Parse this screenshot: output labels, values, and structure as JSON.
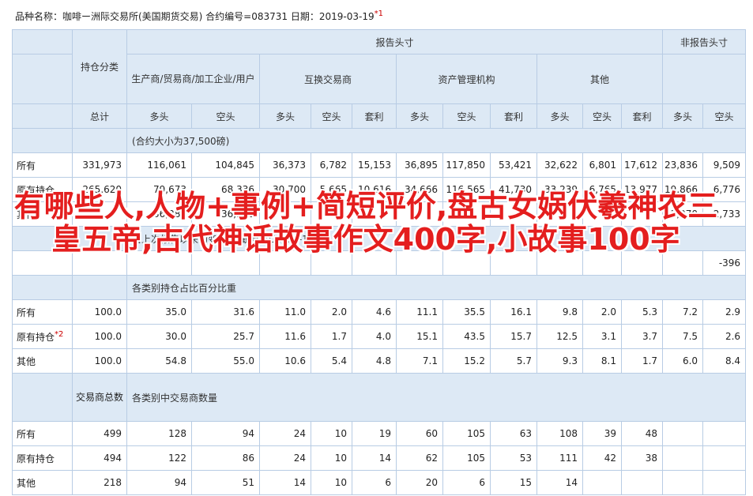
{
  "header_line": {
    "text": "品种名称：咖啡ー洲际交易所(美国期货交易) 合约编号=083731 日期：2019-03-19",
    "note": "*1"
  },
  "table": {
    "row1": {
      "holding_category": "持仓分类",
      "report_header": "报告头寸",
      "nonreport_header": "非报告头寸"
    },
    "row2": {
      "producer": "生产商/贸易商/加工企业/用户",
      "swap": "互换交易商",
      "asset_mgr": "资产管理机构",
      "other": "其他"
    },
    "row3": {
      "total": "总计",
      "cols": [
        "多头",
        "空头",
        "多头",
        "空头",
        "套利",
        "多头",
        "空头",
        "套利",
        "多头",
        "空头",
        "套利",
        "多头",
        "空头"
      ]
    },
    "contract_size": "(合约大小为37,500磅)",
    "block1": [
      {
        "label": "所有",
        "values": [
          "331,973",
          "116,061",
          "104,845",
          "36,373",
          "6,782",
          "15,153",
          "36,895",
          "117,850",
          "53,421",
          "32,622",
          "6,801",
          "17,612",
          "23,836",
          "9,509"
        ]
      },
      {
        "label": "原有持仓",
        "values": [
          "265,620",
          "79,673",
          "68,336",
          "30,700",
          "5,665",
          "10,616",
          "34,666",
          "116,565",
          "41,730",
          "33,239",
          "6,765",
          "13,977",
          "19,866",
          "6,776"
        ]
      },
      {
        "label": "其他",
        "values": [
          "",
          "36,388",
          "36,510",
          "",
          "",
          "",
          "",
          "",
          "",
          "",
          "",
          "",
          "3,970",
          "2,733"
        ]
      }
    ],
    "change_header": "自上次报告以来的变化量(截至2019-03-12)",
    "change_row": {
      "values": [
        "",
        "",
        "",
        "",
        "",
        "",
        "",
        "",
        "",
        "",
        "",
        "",
        "",
        "-396"
      ]
    },
    "pct_header": "各类别持仓占比百分比重",
    "block2": [
      {
        "label": "所有",
        "values": [
          "100.0",
          "35.0",
          "31.6",
          "11.0",
          "2.0",
          "4.6",
          "11.1",
          "35.5",
          "16.1",
          "9.8",
          "2.0",
          "5.3",
          "7.2",
          "2.9"
        ]
      },
      {
        "label": "原有持仓",
        "note": "*2",
        "values": [
          "100.0",
          "30.0",
          "25.7",
          "11.6",
          "1.7",
          "4.0",
          "15.1",
          "43.5",
          "15.7",
          "12.5",
          "3.1",
          "3.7",
          "7.5",
          "2.6"
        ]
      },
      {
        "label": "其他",
        "values": [
          "100.0",
          "54.8",
          "55.0",
          "10.6",
          "5.4",
          "4.8",
          "7.1",
          "15.2",
          "5.7",
          "9.3",
          "8.1",
          "1.7",
          "6.0",
          "8.4"
        ]
      }
    ],
    "trader_count": "交易商总数",
    "trader_header": "各类别中交易商数量",
    "block3": [
      {
        "label": "所有",
        "values": [
          "499",
          "128",
          "94",
          "24",
          "10",
          "19",
          "60",
          "105",
          "63",
          "108",
          "39",
          "48",
          "",
          ""
        ]
      },
      {
        "label": "原有持仓",
        "values": [
          "494",
          "122",
          "86",
          "24",
          "10",
          "14",
          "62",
          "105",
          "53",
          "111",
          "42",
          "38",
          "",
          ""
        ]
      },
      {
        "label": "其他",
        "values": [
          "218",
          "94",
          "51",
          "14",
          "10",
          "6",
          "20",
          "6",
          "15",
          "14",
          "",
          "",
          "",
          ""
        ]
      }
    ]
  },
  "overlay_title": "有哪些人,人物+事例+简短评价,盘古女娲伏羲神农三皇五帝,古代神话故事作文400字,小故事100字"
}
